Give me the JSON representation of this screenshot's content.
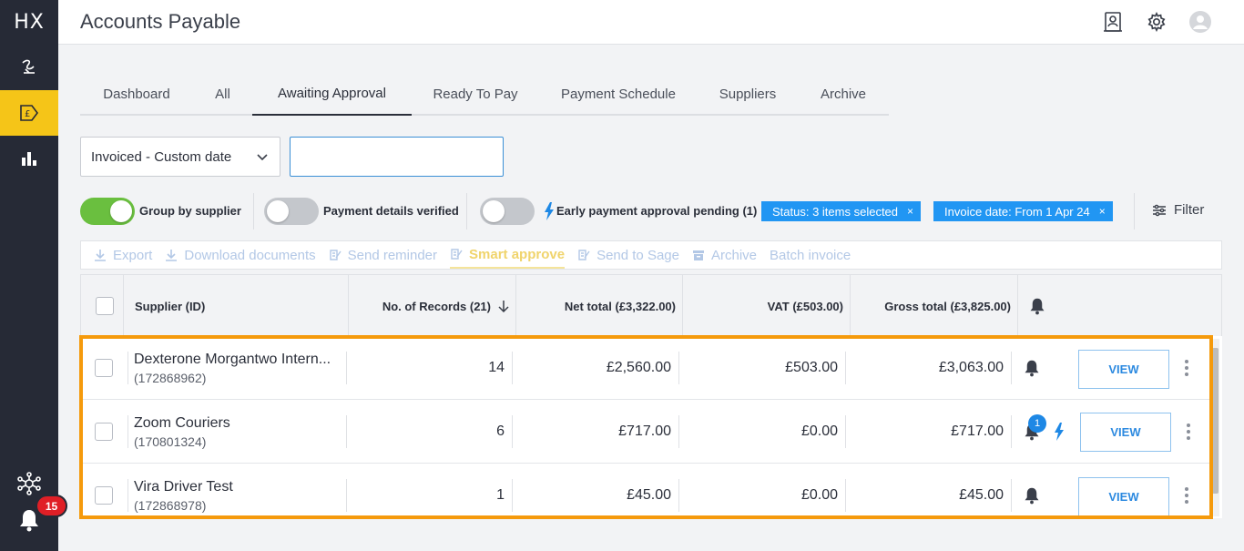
{
  "app": {
    "logo_text": "HX",
    "title": "Accounts Payable",
    "notification_count": "15",
    "accent_color": "#f5c518",
    "highlight_color": "#f59a0c"
  },
  "sidebar": {
    "items": [
      {
        "icon": "signature-icon"
      },
      {
        "icon": "pound-invoice-icon",
        "active": true
      },
      {
        "icon": "bar-chart-icon"
      }
    ],
    "bottom": [
      {
        "icon": "network-hub-icon"
      },
      {
        "icon": "bell-icon"
      }
    ]
  },
  "header": {
    "icons": [
      "contacts-icon",
      "gear-icon",
      "user-avatar-icon"
    ]
  },
  "tabs": [
    {
      "label": "Dashboard"
    },
    {
      "label": "All"
    },
    {
      "label": "Awaiting Approval",
      "active": true
    },
    {
      "label": "Ready To Pay"
    },
    {
      "label": "Payment Schedule"
    },
    {
      "label": "Suppliers"
    },
    {
      "label": "Archive"
    }
  ],
  "filters": {
    "date_select": "Invoiced - Custom date",
    "search_value": "",
    "toggles": [
      {
        "label": "Group by supplier",
        "on": true
      },
      {
        "label": "Payment details verified",
        "on": false
      },
      {
        "label": "Early payment approval pending (1)",
        "on": false
      }
    ],
    "chips": [
      {
        "label": "Status: 3 items selected"
      },
      {
        "label": "Invoice date: From 1 Apr 24"
      }
    ],
    "chip_close": "×",
    "filter_label": "Filter"
  },
  "actions": [
    {
      "label": "Export"
    },
    {
      "label": "Download documents"
    },
    {
      "label": "Send reminder"
    },
    {
      "label": "Smart approve"
    },
    {
      "label": "Send to Sage"
    },
    {
      "label": "Archive"
    },
    {
      "label": "Batch invoice"
    }
  ],
  "table": {
    "columns": {
      "supplier": "Supplier (ID)",
      "records": "No. of Records (21)",
      "net": "Net total (£3,322.00)",
      "vat": "VAT (£503.00)",
      "gross": "Gross total (£3,825.00)"
    },
    "rows": [
      {
        "name": "Dexterone Morgantwo Intern...",
        "id": "(172868962)",
        "records": "14",
        "net": "£2,560.00",
        "vat": "£503.00",
        "gross": "£3,063.00",
        "view": "VIEW"
      },
      {
        "name": "Zoom Couriers",
        "id": "(170801324)",
        "records": "6",
        "net": "£717.00",
        "vat": "£0.00",
        "gross": "£717.00",
        "view": "VIEW",
        "bell_count": "1",
        "early_payment": true
      },
      {
        "name": "Vira Driver Test",
        "id": "(172868978)",
        "records": "1",
        "net": "£45.00",
        "vat": "£0.00",
        "gross": "£45.00",
        "view": "VIEW"
      }
    ]
  }
}
